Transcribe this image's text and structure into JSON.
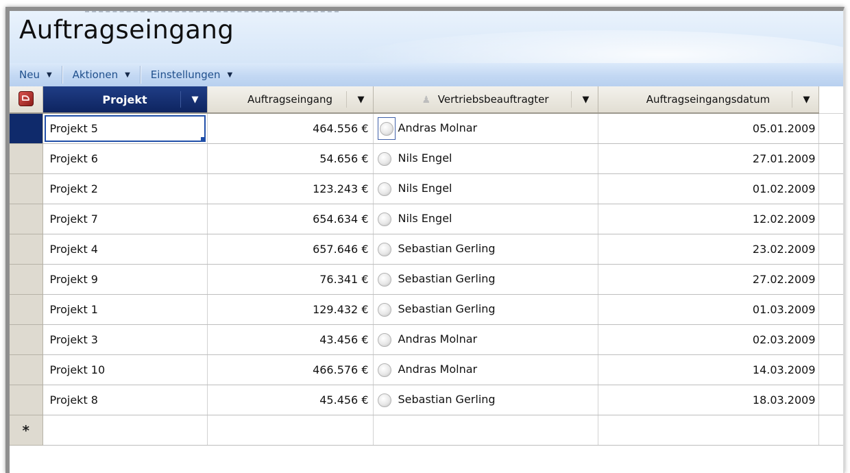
{
  "window": {
    "title": "Auftragseingang"
  },
  "toolbar": {
    "items": [
      {
        "label": "Neu"
      },
      {
        "label": "Aktionen"
      },
      {
        "label": "Einstellungen"
      }
    ]
  },
  "grid": {
    "columns": [
      {
        "label": "Projekt",
        "active": true
      },
      {
        "label": "Auftragseingang"
      },
      {
        "label": "Vertriebsbeauftragter",
        "icon": "person-icon"
      },
      {
        "label": "Auftragseingangsdatum"
      }
    ],
    "rows": [
      {
        "projekt": "Projekt 5",
        "betrag": "464.556 €",
        "vertrieb": "Andras Molnar",
        "datum": "05.01.2009"
      },
      {
        "projekt": "Projekt 6",
        "betrag": "54.656 €",
        "vertrieb": "Nils Engel",
        "datum": "27.01.2009"
      },
      {
        "projekt": "Projekt 2",
        "betrag": "123.243 €",
        "vertrieb": "Nils Engel",
        "datum": "01.02.2009"
      },
      {
        "projekt": "Projekt 7",
        "betrag": "654.634 €",
        "vertrieb": "Nils Engel",
        "datum": "12.02.2009"
      },
      {
        "projekt": "Projekt 4",
        "betrag": "657.646 €",
        "vertrieb": "Sebastian Gerling",
        "datum": "23.02.2009"
      },
      {
        "projekt": "Projekt 9",
        "betrag": "76.341 €",
        "vertrieb": "Sebastian Gerling",
        "datum": "27.02.2009"
      },
      {
        "projekt": "Projekt 1",
        "betrag": "129.432 €",
        "vertrieb": "Sebastian Gerling",
        "datum": "01.03.2009"
      },
      {
        "projekt": "Projekt 3",
        "betrag": "43.456 €",
        "vertrieb": "Andras Molnar",
        "datum": "02.03.2009"
      },
      {
        "projekt": "Projekt 10",
        "betrag": "466.576 €",
        "vertrieb": "Andras Molnar",
        "datum": "14.03.2009"
      },
      {
        "projekt": "Projekt 8",
        "betrag": "45.456 €",
        "vertrieb": "Sebastian Gerling",
        "datum": "18.03.2009"
      }
    ],
    "new_row_marker": "*"
  },
  "colors": {
    "active_header": "#0e2460",
    "toolbar_text": "#1f4f8c",
    "title_band": "#d6e6f8"
  }
}
